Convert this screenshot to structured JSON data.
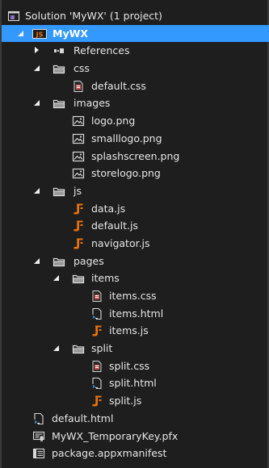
{
  "solution": {
    "label": "Solution 'MyWX' (1 project)"
  },
  "project": {
    "label": "MyWX",
    "badge": "JS"
  },
  "references": {
    "label": "References"
  },
  "css_folder": {
    "label": "css",
    "files": [
      {
        "label": "default.css"
      }
    ]
  },
  "images_folder": {
    "label": "images",
    "files": [
      {
        "label": "logo.png"
      },
      {
        "label": "smalllogo.png"
      },
      {
        "label": "splashscreen.png"
      },
      {
        "label": "storelogo.png"
      }
    ]
  },
  "js_folder": {
    "label": "js",
    "files": [
      {
        "label": "data.js"
      },
      {
        "label": "default.js"
      },
      {
        "label": "navigator.js"
      }
    ]
  },
  "pages_folder": {
    "label": "pages",
    "items_folder": {
      "label": "items",
      "files": [
        {
          "label": "items.css"
        },
        {
          "label": "items.html"
        },
        {
          "label": "items.js"
        }
      ]
    },
    "split_folder": {
      "label": "split",
      "files": [
        {
          "label": "split.css"
        },
        {
          "label": "split.html"
        },
        {
          "label": "split.js"
        }
      ]
    }
  },
  "root_files": [
    {
      "label": "default.html"
    },
    {
      "label": "MyWX_TemporaryKey.pfx"
    },
    {
      "label": "package.appxmanifest"
    }
  ],
  "colors": {
    "background": "#1e1e1e",
    "selection": "#3399ff",
    "js_icon": "#e8730c",
    "text": "#e6e6e6"
  },
  "icons": {
    "solution": "solution-icon",
    "project": "js-project-icon",
    "references": "references-icon",
    "folder": "folder-icon",
    "css_file": "css-file-icon",
    "image_file": "image-file-icon",
    "js_file": "js-file-icon",
    "html_file": "html-file-icon",
    "certificate": "certificate-icon",
    "manifest": "manifest-icon"
  }
}
